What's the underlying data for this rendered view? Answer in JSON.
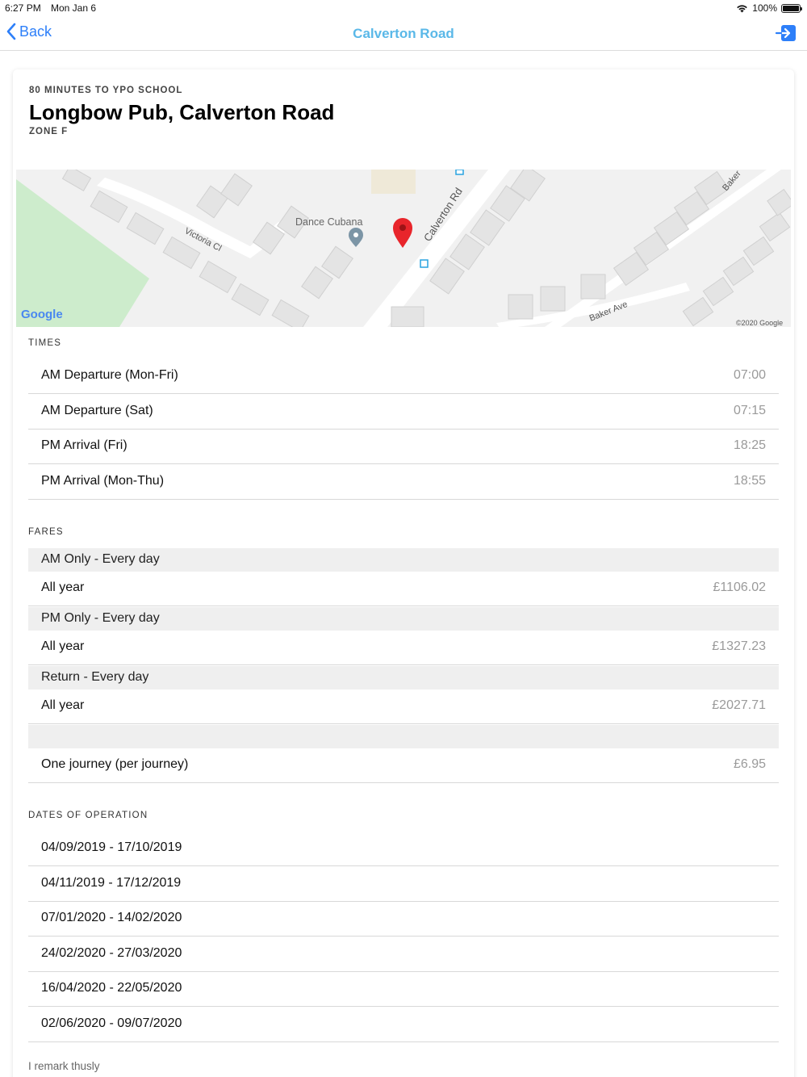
{
  "status": {
    "time": "6:27 PM",
    "date": "Mon Jan 6",
    "battery": "100%"
  },
  "nav": {
    "back_label": "Back",
    "title": "Calverton Road",
    "icons": {
      "back": "chevron-left-icon",
      "action": "sign-in-arrow-icon"
    }
  },
  "header": {
    "eyebrow": "80 MINUTES TO YPO SCHOOL",
    "title": "Longbow Pub, Calverton Road",
    "zone": "ZONE F"
  },
  "map": {
    "labels": {
      "place": "Dance Cubana",
      "road_main": "Calverton Rd",
      "road_side": "Victoria Cl",
      "road_baker_ave": "Baker Ave",
      "road_baker": "Baker",
      "brand": "Google",
      "copyright": "©2020 Google"
    },
    "pin_color": "#e8252b"
  },
  "times": {
    "label": "TIMES",
    "rows": [
      {
        "label": "AM Departure (Mon-Fri)",
        "value": "07:00"
      },
      {
        "label": "AM Departure (Sat)",
        "value": "07:15"
      },
      {
        "label": "PM Arrival (Fri)",
        "value": "18:25"
      },
      {
        "label": "PM Arrival (Mon-Thu)",
        "value": "18:55"
      }
    ]
  },
  "fares": {
    "label": "FARES",
    "groups": [
      {
        "header": "AM Only - Every day",
        "row": {
          "label": "All year",
          "value": "£1106.02"
        }
      },
      {
        "header": "PM Only - Every day",
        "row": {
          "label": "All year",
          "value": "£1327.23"
        }
      },
      {
        "header": "Return - Every day",
        "row": {
          "label": "All year",
          "value": "£2027.71"
        }
      },
      {
        "header": "",
        "row": {
          "label": "One journey (per journey)",
          "value": "£6.95"
        }
      }
    ]
  },
  "dates": {
    "label": "DATES OF OPERATION",
    "rows": [
      "04/09/2019 - 17/10/2019",
      "04/11/2019 - 17/12/2019",
      "07/01/2020 - 14/02/2020",
      "24/02/2020 - 27/03/2020",
      "16/04/2020 - 22/05/2020",
      "02/06/2020 - 09/07/2020"
    ]
  },
  "footer": {
    "note": "I remark thusly"
  }
}
